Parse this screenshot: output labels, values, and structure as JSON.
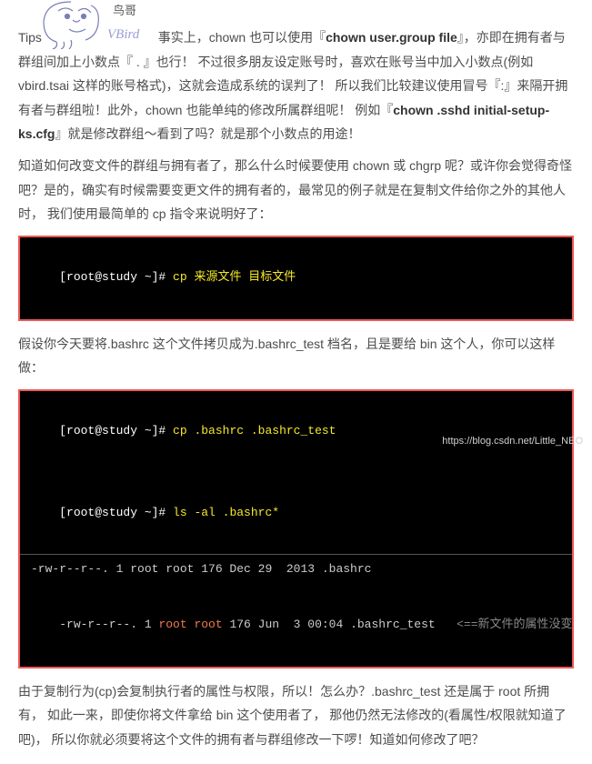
{
  "doodle": {
    "label_cn": "鸟哥",
    "label_en": "VBird"
  },
  "p1": {
    "tips": "Tips",
    "body_a": "事实上，chown 也可以使用『",
    "bold_a": "chown user.group file",
    "body_b": "』，亦即在拥有者与群组间加上小数点『 . 』也行！  不过很多朋友设定账号时，喜欢在账号当中加入小数点(例如 vbird.tsai 这样的账号格式)，这就会造成系统的误判了！  所以我们比较建议使用冒号『:』来隔开拥有者与群组啦！此外，chown 也能单纯的修改所属群组呢！  例如『",
    "bold_b": "chown .sshd initial-setup-ks.cfg",
    "body_c": "』就是修改群组～看到了吗？就是那个小数点的用途！"
  },
  "p2": "知道如何改变文件的群组与拥有者了，那么什么时候要使用 chown 或 chgrp 呢？或许你会觉得奇怪吧？是的，确实有时候需要变更文件的拥有者的，最常见的例子就是在复制文件给你之外的其他人时， 我们使用最简单的 cp 指令来说明好了：",
  "code1": {
    "prompt": "[root@study ~]# ",
    "cmd": "cp 来源文件 目标文件"
  },
  "p3": "假设你今天要将.bashrc 这个文件拷贝成为.bashrc_test 档名，且是要给 bin 这个人，你可以这样做：",
  "code2": {
    "l1_prompt": "[root@study ~]# ",
    "l1_cmd": "cp .bashrc .bashrc_test",
    "l2_prompt": "[root@study ~]# ",
    "l2_cmd": "ls -al .bashrc*",
    "l3": "-rw-r--r--. 1 root root 176 Dec 29  2013 .bashrc",
    "l4_a": "-rw-r--r--. 1 ",
    "l4_root": "root root",
    "l4_b": " 176 Jun  3 00:04 .bashrc_test   ",
    "l4_note": "<==新文件的属性没变"
  },
  "p4": "由于复制行为(cp)会复制执行者的属性与权限，所以！怎么办？.bashrc_test 还是属于 root 所拥有， 如此一来，即使你将文件拿给 bin 这个使用者了， 那他仍然无法修改的(看属性/权限就知道了吧)， 所以你就必须要将这个文件的拥有者与群组修改一下啰！知道如何修改了吧？",
  "watermark": "https://blog.csdn.net/Little_NEO"
}
